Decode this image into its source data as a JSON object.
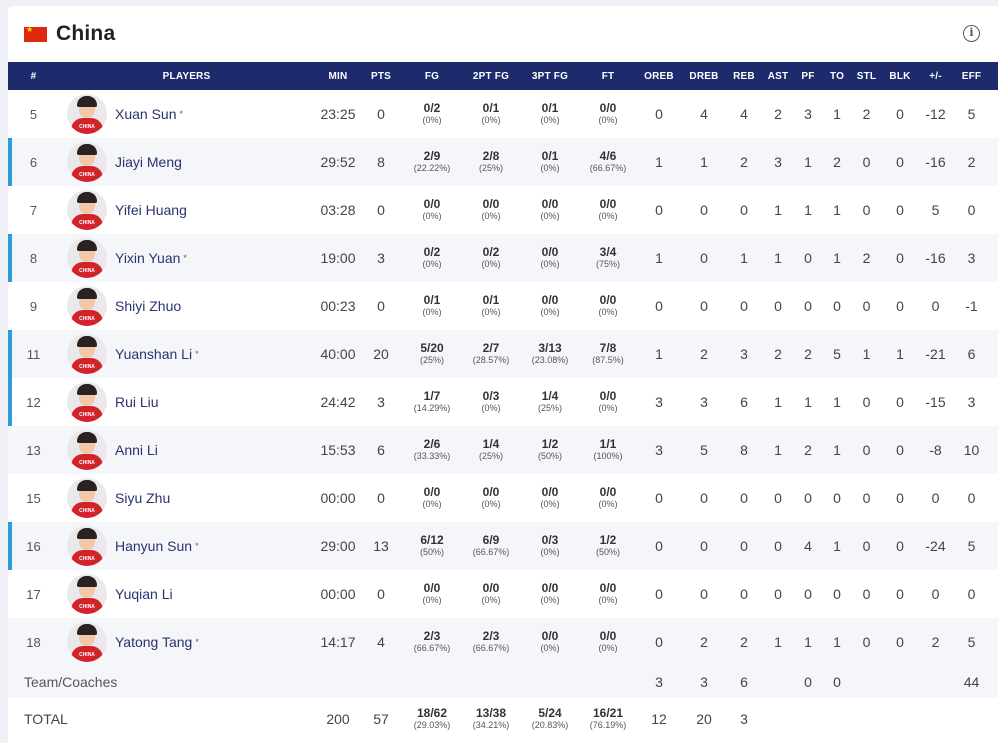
{
  "team": {
    "name": "China"
  },
  "columns": [
    "#",
    "PLAYERS",
    "MIN",
    "PTS",
    "FG",
    "2PT FG",
    "3PT FG",
    "FT",
    "OREB",
    "DREB",
    "REB",
    "AST",
    "PF",
    "TO",
    "STL",
    "BLK",
    "+/-",
    "EFF"
  ],
  "players": [
    {
      "num": "5",
      "name": "Xuan Sun",
      "star": "*",
      "starter": false,
      "min": "23:25",
      "pts": "0",
      "fg": {
        "m": "0/2",
        "p": "(0%)"
      },
      "fg2": {
        "m": "0/1",
        "p": "(0%)"
      },
      "fg3": {
        "m": "0/1",
        "p": "(0%)"
      },
      "ft": {
        "m": "0/0",
        "p": "(0%)"
      },
      "oreb": "0",
      "dreb": "4",
      "reb": "4",
      "ast": "2",
      "pf": "3",
      "to": "1",
      "stl": "2",
      "blk": "0",
      "pm": "-12",
      "eff": "5"
    },
    {
      "num": "6",
      "name": "Jiayi Meng",
      "star": "",
      "starter": true,
      "min": "29:52",
      "pts": "8",
      "fg": {
        "m": "2/9",
        "p": "(22.22%)"
      },
      "fg2": {
        "m": "2/8",
        "p": "(25%)"
      },
      "fg3": {
        "m": "0/1",
        "p": "(0%)"
      },
      "ft": {
        "m": "4/6",
        "p": "(66.67%)"
      },
      "oreb": "1",
      "dreb": "1",
      "reb": "2",
      "ast": "3",
      "pf": "1",
      "to": "2",
      "stl": "0",
      "blk": "0",
      "pm": "-16",
      "eff": "2"
    },
    {
      "num": "7",
      "name": "Yifei Huang",
      "star": "",
      "starter": false,
      "min": "03:28",
      "pts": "0",
      "fg": {
        "m": "0/0",
        "p": "(0%)"
      },
      "fg2": {
        "m": "0/0",
        "p": "(0%)"
      },
      "fg3": {
        "m": "0/0",
        "p": "(0%)"
      },
      "ft": {
        "m": "0/0",
        "p": "(0%)"
      },
      "oreb": "0",
      "dreb": "0",
      "reb": "0",
      "ast": "1",
      "pf": "1",
      "to": "1",
      "stl": "0",
      "blk": "0",
      "pm": "5",
      "eff": "0"
    },
    {
      "num": "8",
      "name": "Yixin Yuan",
      "star": "*",
      "starter": true,
      "min": "19:00",
      "pts": "3",
      "fg": {
        "m": "0/2",
        "p": "(0%)"
      },
      "fg2": {
        "m": "0/2",
        "p": "(0%)"
      },
      "fg3": {
        "m": "0/0",
        "p": "(0%)"
      },
      "ft": {
        "m": "3/4",
        "p": "(75%)"
      },
      "oreb": "1",
      "dreb": "0",
      "reb": "1",
      "ast": "1",
      "pf": "0",
      "to": "1",
      "stl": "2",
      "blk": "0",
      "pm": "-16",
      "eff": "3"
    },
    {
      "num": "9",
      "name": "Shiyi Zhuo",
      "star": "",
      "starter": false,
      "min": "00:23",
      "pts": "0",
      "fg": {
        "m": "0/1",
        "p": "(0%)"
      },
      "fg2": {
        "m": "0/1",
        "p": "(0%)"
      },
      "fg3": {
        "m": "0/0",
        "p": "(0%)"
      },
      "ft": {
        "m": "0/0",
        "p": "(0%)"
      },
      "oreb": "0",
      "dreb": "0",
      "reb": "0",
      "ast": "0",
      "pf": "0",
      "to": "0",
      "stl": "0",
      "blk": "0",
      "pm": "0",
      "eff": "-1"
    },
    {
      "num": "11",
      "name": "Yuanshan Li",
      "star": "*",
      "starter": true,
      "min": "40:00",
      "pts": "20",
      "fg": {
        "m": "5/20",
        "p": "(25%)"
      },
      "fg2": {
        "m": "2/7",
        "p": "(28.57%)"
      },
      "fg3": {
        "m": "3/13",
        "p": "(23.08%)"
      },
      "ft": {
        "m": "7/8",
        "p": "(87.5%)"
      },
      "oreb": "1",
      "dreb": "2",
      "reb": "3",
      "ast": "2",
      "pf": "2",
      "to": "5",
      "stl": "1",
      "blk": "1",
      "pm": "-21",
      "eff": "6"
    },
    {
      "num": "12",
      "name": "Rui Liu",
      "star": "",
      "starter": true,
      "min": "24:42",
      "pts": "3",
      "fg": {
        "m": "1/7",
        "p": "(14.29%)"
      },
      "fg2": {
        "m": "0/3",
        "p": "(0%)"
      },
      "fg3": {
        "m": "1/4",
        "p": "(25%)"
      },
      "ft": {
        "m": "0/0",
        "p": "(0%)"
      },
      "oreb": "3",
      "dreb": "3",
      "reb": "6",
      "ast": "1",
      "pf": "1",
      "to": "1",
      "stl": "0",
      "blk": "0",
      "pm": "-15",
      "eff": "3"
    },
    {
      "num": "13",
      "name": "Anni Li",
      "star": "",
      "starter": false,
      "min": "15:53",
      "pts": "6",
      "fg": {
        "m": "2/6",
        "p": "(33.33%)"
      },
      "fg2": {
        "m": "1/4",
        "p": "(25%)"
      },
      "fg3": {
        "m": "1/2",
        "p": "(50%)"
      },
      "ft": {
        "m": "1/1",
        "p": "(100%)"
      },
      "oreb": "3",
      "dreb": "5",
      "reb": "8",
      "ast": "1",
      "pf": "2",
      "to": "1",
      "stl": "0",
      "blk": "0",
      "pm": "-8",
      "eff": "10"
    },
    {
      "num": "15",
      "name": "Siyu Zhu",
      "star": "",
      "starter": false,
      "min": "00:00",
      "pts": "0",
      "fg": {
        "m": "0/0",
        "p": "(0%)"
      },
      "fg2": {
        "m": "0/0",
        "p": "(0%)"
      },
      "fg3": {
        "m": "0/0",
        "p": "(0%)"
      },
      "ft": {
        "m": "0/0",
        "p": "(0%)"
      },
      "oreb": "0",
      "dreb": "0",
      "reb": "0",
      "ast": "0",
      "pf": "0",
      "to": "0",
      "stl": "0",
      "blk": "0",
      "pm": "0",
      "eff": "0"
    },
    {
      "num": "16",
      "name": "Hanyun Sun",
      "star": "*",
      "starter": true,
      "min": "29:00",
      "pts": "13",
      "fg": {
        "m": "6/12",
        "p": "(50%)"
      },
      "fg2": {
        "m": "6/9",
        "p": "(66.67%)"
      },
      "fg3": {
        "m": "0/3",
        "p": "(0%)"
      },
      "ft": {
        "m": "1/2",
        "p": "(50%)"
      },
      "oreb": "0",
      "dreb": "0",
      "reb": "0",
      "ast": "0",
      "pf": "4",
      "to": "1",
      "stl": "0",
      "blk": "0",
      "pm": "-24",
      "eff": "5"
    },
    {
      "num": "17",
      "name": "Yuqian Li",
      "star": "",
      "starter": false,
      "min": "00:00",
      "pts": "0",
      "fg": {
        "m": "0/0",
        "p": "(0%)"
      },
      "fg2": {
        "m": "0/0",
        "p": "(0%)"
      },
      "fg3": {
        "m": "0/0",
        "p": "(0%)"
      },
      "ft": {
        "m": "0/0",
        "p": "(0%)"
      },
      "oreb": "0",
      "dreb": "0",
      "reb": "0",
      "ast": "0",
      "pf": "0",
      "to": "0",
      "stl": "0",
      "blk": "0",
      "pm": "0",
      "eff": "0"
    },
    {
      "num": "18",
      "name": "Yatong Tang",
      "star": "*",
      "starter": false,
      "min": "14:17",
      "pts": "4",
      "fg": {
        "m": "2/3",
        "p": "(66.67%)"
      },
      "fg2": {
        "m": "2/3",
        "p": "(66.67%)"
      },
      "fg3": {
        "m": "0/0",
        "p": "(0%)"
      },
      "ft": {
        "m": "0/0",
        "p": "(0%)"
      },
      "oreb": "0",
      "dreb": "2",
      "reb": "2",
      "ast": "1",
      "pf": "1",
      "to": "1",
      "stl": "0",
      "blk": "0",
      "pm": "2",
      "eff": "5"
    }
  ],
  "team_row": {
    "label": "Team/Coaches",
    "oreb": "3",
    "dreb": "3",
    "reb": "6",
    "pf": "0",
    "to": "0",
    "eff": "44"
  },
  "total_row": {
    "label": "TOTAL",
    "min": "200",
    "pts": "57",
    "fg": {
      "m": "18/62",
      "p": "(29.03%)"
    },
    "fg2": {
      "m": "13/38",
      "p": "(34.21%)"
    },
    "fg3": {
      "m": "5/24",
      "p": "(20.83%)"
    },
    "ft": {
      "m": "16/21",
      "p": "(76.19%)"
    },
    "oreb": "12",
    "dreb": "20",
    "reb": "3"
  },
  "colors": {
    "header_bg": "#1d2a6b",
    "starter_marker": "#2e9ad8",
    "flag_red": "#de2910"
  },
  "icons": {
    "info": "info-circle-icon",
    "flag": "china-flag-icon"
  }
}
